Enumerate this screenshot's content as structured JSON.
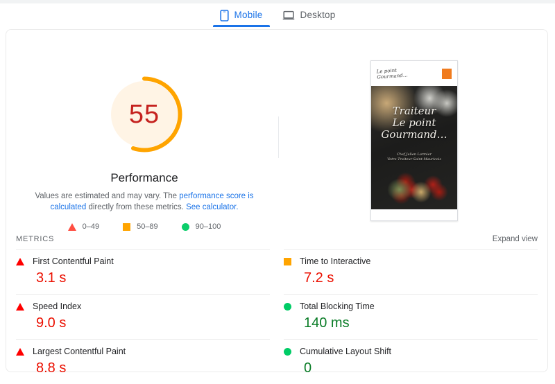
{
  "tabs": [
    {
      "label": "Mobile",
      "icon": "mobile-phone-icon",
      "active": true
    },
    {
      "label": "Desktop",
      "icon": "desktop-laptop-icon",
      "active": false
    }
  ],
  "score": {
    "value": "55",
    "value_number": 55,
    "category_label": "Performance",
    "arc_color": "#ffa400",
    "number_color": "#c5221f",
    "track_color": "#fff4e5"
  },
  "description": {
    "part1": "Values are estimated and may vary. The ",
    "link1": "performance score is calculated",
    "part2": " directly from these metrics. ",
    "link2": "See calculator."
  },
  "legend": [
    {
      "icon": "red-triangle-icon",
      "label": "0–49",
      "color": "#ff4e42"
    },
    {
      "icon": "orange-square-icon",
      "label": "50–89",
      "color": "#ffa400"
    },
    {
      "icon": "green-circle-icon",
      "label": "90–100",
      "color": "#0cce6b"
    }
  ],
  "thumbnail": {
    "logo_line1": "Le point",
    "logo_line2": "Gourmand…",
    "menu_icon": "hamburger-menu-icon",
    "hero_line1": "Traiteur",
    "hero_line2": "Le point",
    "hero_line3": "Gourmand…",
    "hero_sub1": "Chef Julien Larmier",
    "hero_sub2": "Votre Traiteur Saint-Mauricois"
  },
  "metrics_header": {
    "title": "METRICS",
    "expand_label": "Expand view"
  },
  "metrics": {
    "left": [
      {
        "icon": "red-triangle-icon",
        "label": "First Contentful Paint",
        "value": "3.1 s",
        "value_class": "v-red",
        "icon_class": "ic-tri"
      },
      {
        "icon": "red-triangle-icon",
        "label": "Speed Index",
        "value": "9.0 s",
        "value_class": "v-red",
        "icon_class": "ic-tri"
      },
      {
        "icon": "red-triangle-icon",
        "label": "Largest Contentful Paint",
        "value": "8.8 s",
        "value_class": "v-red",
        "icon_class": "ic-tri"
      }
    ],
    "right": [
      {
        "icon": "orange-square-icon",
        "label": "Time to Interactive",
        "value": "7.2 s",
        "value_class": "v-red",
        "icon_class": "ic-sq"
      },
      {
        "icon": "green-circle-icon",
        "label": "Total Blocking Time",
        "value": "140 ms",
        "value_class": "v-green",
        "icon_class": "ic-cir"
      },
      {
        "icon": "green-circle-icon",
        "label": "Cumulative Layout Shift",
        "value": "0",
        "value_class": "v-green",
        "icon_class": "ic-cir"
      }
    ]
  }
}
